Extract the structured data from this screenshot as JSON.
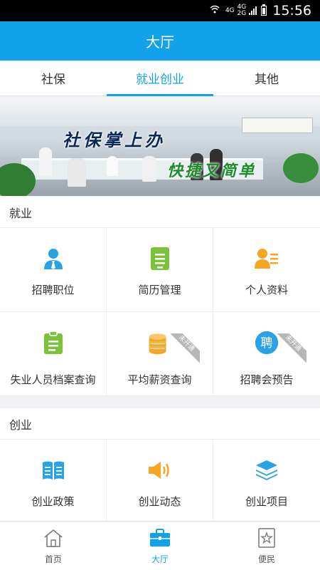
{
  "status_bar": {
    "network_top": "4G",
    "network_bottom": "4G",
    "network_bottom2": "2G",
    "time": "15:56"
  },
  "app_bar": {
    "title": "大厅"
  },
  "tabs": [
    {
      "label": "社保",
      "active": false
    },
    {
      "label": "就业创业",
      "active": true
    },
    {
      "label": "其他",
      "active": false
    }
  ],
  "banner": {
    "slogan_line1": "社保掌上办",
    "slogan_line2": "快捷又简单"
  },
  "sections": [
    {
      "title": "就业",
      "items": [
        {
          "label": "招聘职位",
          "icon": "user-tie-icon",
          "color": "#2aa3e6"
        },
        {
          "label": "简历管理",
          "icon": "document-icon",
          "color": "#7cc33b"
        },
        {
          "label": "个人资料",
          "icon": "id-card-icon",
          "color": "#f5a623"
        },
        {
          "label": "失业人员档案查询",
          "icon": "clipboard-icon",
          "color": "#7cc33b"
        },
        {
          "label": "平均薪资查询",
          "icon": "coins-icon",
          "color": "#f5a623",
          "badge": "未开通"
        },
        {
          "label": "招聘会预告",
          "icon": "recruit-icon",
          "color": "#2aa3e6",
          "badge": "未开通",
          "icon_text": "聘"
        }
      ]
    },
    {
      "title": "创业",
      "items": [
        {
          "label": "创业政策",
          "icon": "book-icon",
          "color": "#2aa3e6"
        },
        {
          "label": "创业动态",
          "icon": "speaker-icon",
          "color": "#f5a623"
        },
        {
          "label": "创业项目",
          "icon": "layers-icon",
          "color": "#2aa3e6"
        }
      ]
    }
  ],
  "bottom_nav": [
    {
      "label": "首页",
      "icon": "home-icon",
      "active": false
    },
    {
      "label": "大厅",
      "icon": "briefcase-icon",
      "active": true
    },
    {
      "label": "便民",
      "icon": "star-icon",
      "active": false
    }
  ],
  "colors": {
    "primary": "#11a2ea",
    "green": "#7cc33b",
    "orange": "#f5a623",
    "blue": "#2aa3e6"
  }
}
